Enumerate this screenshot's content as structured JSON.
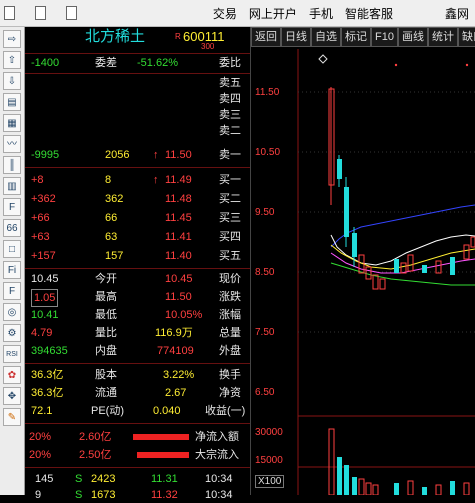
{
  "menu": {
    "items": [
      "交易",
      "网上开户",
      "手机",
      "智能客服",
      "鑫网"
    ]
  },
  "toolbar_icons": [
    "arrow-right-icon",
    "arrow-up-icon",
    "arrow-down-icon",
    "report-icon",
    "table-icon",
    "line-chart-icon",
    "candle-icon",
    "grid-icon",
    "f10-icon",
    "sixty-six-icon",
    "box-icon",
    "f11-icon",
    "f12-icon",
    "circle-icon",
    "gear-icon",
    "rsi-icon",
    "bug-icon",
    "cross-icon",
    "pencil-icon"
  ],
  "stock": {
    "code": "600111",
    "name": "北方稀土",
    "label_r": "R",
    "num": "300"
  },
  "weibi": {
    "label": "委比",
    "value": "-51.62%",
    "label2": "委差",
    "value2": "-1400"
  },
  "sell": [
    {
      "label": "卖五",
      "price": "",
      "vol": "",
      "chg": ""
    },
    {
      "label": "卖四",
      "price": "",
      "vol": "",
      "chg": ""
    },
    {
      "label": "卖三",
      "price": "",
      "vol": "",
      "chg": ""
    },
    {
      "label": "卖二",
      "price": "",
      "vol": "",
      "chg": ""
    },
    {
      "label": "卖一",
      "price": "11.50",
      "vol": "2056",
      "chg": "-9995"
    }
  ],
  "buy": [
    {
      "label": "买一",
      "price": "11.49",
      "vol": "8",
      "chg": "+8"
    },
    {
      "label": "买二",
      "price": "11.48",
      "vol": "362",
      "chg": "+362"
    },
    {
      "label": "买三",
      "price": "11.45",
      "vol": "66",
      "chg": "+66"
    },
    {
      "label": "买四",
      "price": "11.41",
      "vol": "63",
      "chg": "+63"
    },
    {
      "label": "买五",
      "price": "11.40",
      "vol": "157",
      "chg": "+157"
    }
  ],
  "quote": [
    {
      "l1": "现价",
      "v1": "10.45",
      "l2": "今开",
      "v2": "10.45"
    },
    {
      "l1": "涨跌",
      "v1": "11.50",
      "l2": "最高",
      "v2": "1.05"
    },
    {
      "l1": "涨幅",
      "v1": "10.05%",
      "l2": "最低",
      "v2": "10.41"
    },
    {
      "l1": "总量",
      "v1": "116.9万",
      "l2": "量比",
      "v2": "4.79"
    },
    {
      "l1": "外盘",
      "v1": "774109",
      "l2": "内盘",
      "v2": "394635"
    }
  ],
  "fin": [
    {
      "l1": "换手",
      "v1": "3.22%",
      "l2": "股本",
      "v2": "36.3亿"
    },
    {
      "l1": "净资",
      "v1": "2.67",
      "l2": "流通",
      "v2": "36.3亿"
    },
    {
      "l1": "收益(一)",
      "v1": "0.040",
      "l2": "PE(动)",
      "v2": "72.1"
    }
  ],
  "flows": [
    {
      "label": "净流入额",
      "value": "2.60亿",
      "pct": "20%"
    },
    {
      "label": "大宗流入",
      "value": "2.50亿",
      "pct": "20%"
    }
  ],
  "ticks": [
    {
      "time": "10:34",
      "price": "11.31",
      "vol": "2423",
      "flag": "S",
      "num": "145"
    },
    {
      "time": "10:34",
      "price": "11.32",
      "vol": "1673",
      "flag": "S",
      "num": "9"
    }
  ],
  "chart_tabs": [
    "返回",
    "日线",
    "自选",
    "标记",
    "F10",
    "画线",
    "统计",
    "缺口"
  ],
  "chart": {
    "y_labels": [
      "11.50",
      "10.50",
      "9.50",
      "8.50",
      "7.50",
      "6.50"
    ],
    "vol_labels": [
      "30000",
      "15000"
    ],
    "vol_unit": "X100"
  },
  "colors": {
    "up": "#ff4040",
    "down": "#33dd33",
    "neutral": "#e8e8e8",
    "accent": "#22dddd"
  }
}
